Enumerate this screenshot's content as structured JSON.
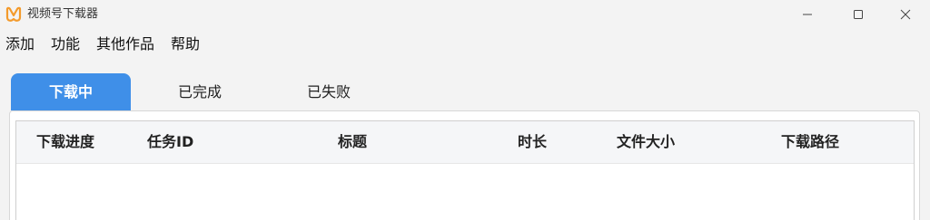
{
  "window": {
    "title": "视频号下载器",
    "icon": "app-logo-icon",
    "controls": {
      "minimize_icon": "minimize-icon",
      "maximize_icon": "maximize-icon",
      "close_icon": "close-icon"
    }
  },
  "menu": {
    "items": [
      {
        "label": "添加"
      },
      {
        "label": "功能"
      },
      {
        "label": "其他作品"
      },
      {
        "label": "帮助"
      }
    ]
  },
  "tabs": [
    {
      "label": "下载中",
      "active": true
    },
    {
      "label": "已完成",
      "active": false
    },
    {
      "label": "已失败",
      "active": false
    }
  ],
  "table": {
    "columns": [
      "下载进度",
      "任务ID",
      "标题",
      "时长",
      "文件大小",
      "下载路径"
    ],
    "rows": []
  },
  "colors": {
    "accent": "#3f8fe8",
    "logo": "#f39a2b",
    "background": "#f3f3f3"
  }
}
